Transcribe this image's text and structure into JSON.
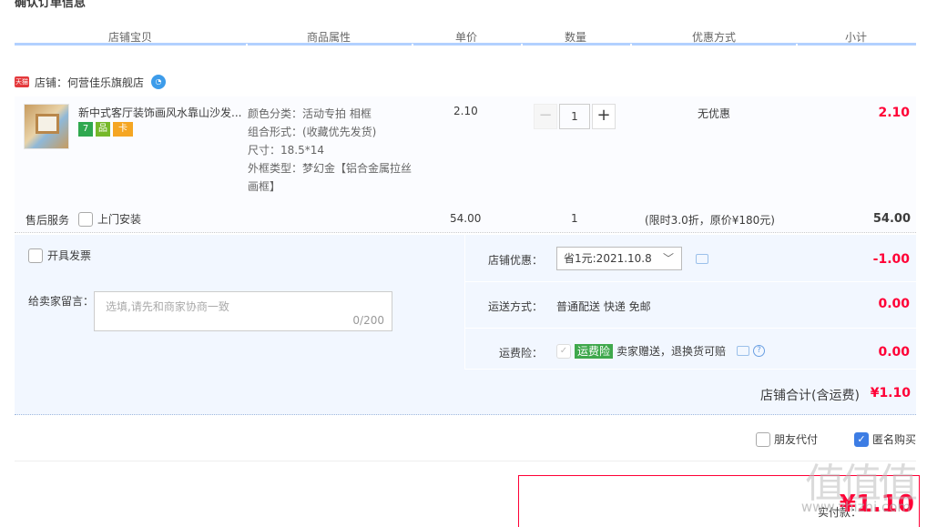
{
  "section_title": "确认订单信息",
  "header": {
    "cols": [
      "店铺宝贝",
      "商品属性",
      "单价",
      "数量",
      "优惠方式",
      "小计"
    ]
  },
  "shop": {
    "label": "店铺：何营佳乐旗舰店",
    "tmall_badge": "天猫"
  },
  "item": {
    "title": "新中式客厅装饰画风水靠山沙发...",
    "badges": [
      "7",
      "品",
      "卡"
    ],
    "props": [
      "颜色分类：活动专拍 相框",
      "组合形式：(收藏优先发货)",
      "尺寸：18.5*14",
      "外框类型：梦幻金【铝合金属拉丝",
      "画框】"
    ],
    "price": "2.10",
    "qty_minus": "−",
    "qty_value": "1",
    "qty_plus": "+",
    "promo": "无优惠",
    "subtotal": "2.10"
  },
  "service": {
    "label": "售后服务",
    "option": "上门安装",
    "price": "54.00",
    "qty": "1",
    "promo": "(限时3.0折，原价¥180元)",
    "subtotal": "54.00"
  },
  "invoice": {
    "label": "开具发票"
  },
  "message": {
    "label": "给卖家留言：",
    "placeholder": "选填,请先和商家协商一致",
    "count": "0/200"
  },
  "shop_discount": {
    "label": "店铺优惠：",
    "selected": "省1元:2021.10.8",
    "amount": "-1.00"
  },
  "shipping": {
    "label": "运送方式：",
    "value": "普通配送 快递 免邮",
    "amount": "0.00"
  },
  "insurance": {
    "label": "运费险：",
    "tag": "运费险",
    "desc": "卖家赠送，退换货可赔",
    "amount": "0.00"
  },
  "shop_total": {
    "label": "店铺合计(含运费)",
    "amount": "¥1.10"
  },
  "options": {
    "friend_pay": "朋友代付",
    "anonymous": "匿名购买"
  },
  "pay": {
    "label": "实付款：",
    "amount": "¥1.10"
  },
  "watermark": {
    "big": "值值值",
    "small": "www.zhizhi.com"
  },
  "colors": {
    "accent": "#ff0036",
    "panel_bg": "#f2f7ff",
    "header_line": "#b2d1ff",
    "check_blue": "#3d7de4"
  }
}
